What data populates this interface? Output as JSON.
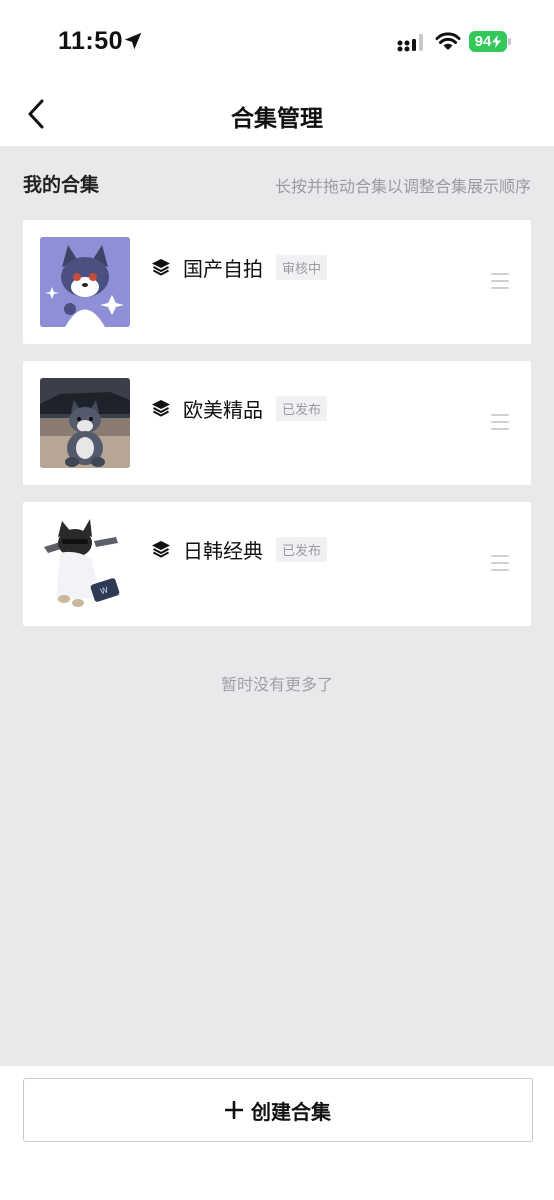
{
  "status_bar": {
    "time": "11:50",
    "battery": "94",
    "icons": [
      "location-arrow-icon",
      "signal-icon",
      "wifi-icon",
      "battery-icon"
    ]
  },
  "nav": {
    "title": "合集管理",
    "back_icon": "chevron-left-icon"
  },
  "section": {
    "title": "我的合集",
    "hint": "长按并拖动合集以调整合集展示顺序"
  },
  "collections": [
    {
      "name": "国产自拍",
      "status": "审核中",
      "thumb_bg": "#8e8fd6"
    },
    {
      "name": "欧美精品",
      "status": "已发布",
      "thumb_bg": "#6b5e55"
    },
    {
      "name": "日韩经典",
      "status": "已发布",
      "thumb_bg": "#ffffff"
    }
  ],
  "footer_text": "暂时没有更多了",
  "create_button": {
    "label": "创建合集",
    "icon": "plus-icon"
  },
  "colors": {
    "background": "#e9e9ec",
    "battery_green": "#34c759",
    "hint_gray": "#9a9aa0"
  }
}
